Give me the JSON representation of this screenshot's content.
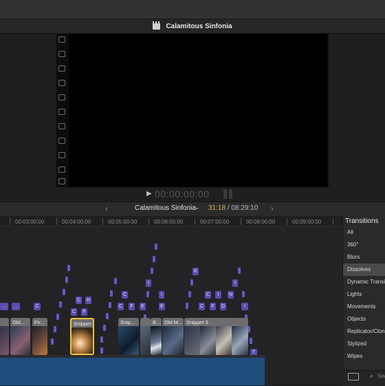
{
  "viewer": {
    "title": "Calamitous Sinfonia",
    "timecode": "00:00:00:00"
  },
  "timeline": {
    "project_name": "Calamitous Sinfonia",
    "duration_current": "31:18",
    "duration_total": "/ 08:29:10",
    "ruler_labels": [
      "00:03:00:00",
      "00:04:00:00",
      "00:05:00:00",
      "00:06:00:00",
      "00:07:00:00",
      "00:08:00:00",
      "00:09:00:00"
    ],
    "clips": [
      {
        "name": "Old..."
      },
      {
        "name": "Fir..."
      },
      {
        "name": "Snippet"
      },
      {
        "name": "Snip..."
      },
      {
        "name": "B..."
      },
      {
        "name": "Old M..."
      },
      {
        "name": "Snippet 3"
      }
    ],
    "tags": [
      "...",
      "...",
      "C",
      "C",
      "H",
      "C",
      "F",
      "C",
      "C",
      "F",
      "E",
      "I",
      "I",
      "E",
      "C",
      "F",
      "D",
      "C",
      "I",
      "T",
      "K",
      "I",
      "N"
    ]
  },
  "transitions": {
    "title": "Transitions",
    "items": [
      "All",
      "360°",
      "Blurs",
      "Dissolves",
      "Dynamic Transitions",
      "Lights",
      "Movements",
      "Objects",
      "Replicator/Clones",
      "Stylized",
      "Wipes"
    ],
    "selected": "Dissolves",
    "search_placeholder": "Search"
  },
  "colors": {
    "accent_purple": "#5b4bb0",
    "selection_yellow": "#f2c43a",
    "audio_blue": "#1e4d7c",
    "timecode_orange": "#e2b14a"
  }
}
